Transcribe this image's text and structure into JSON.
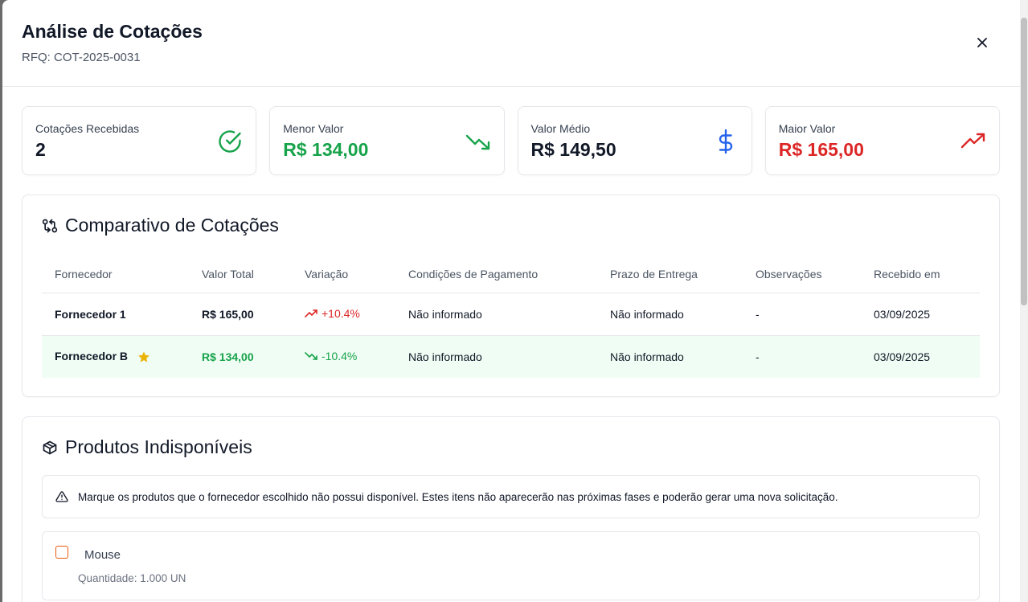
{
  "header": {
    "title": "Análise de Cotações",
    "subtitle": "RFQ: COT-2025-0031",
    "close_icon": "close-icon"
  },
  "stats": [
    {
      "label": "Cotações Recebidas",
      "value": "2",
      "icon": "check-circle-icon",
      "color": "#16a34a",
      "value_color": "#111827"
    },
    {
      "label": "Menor Valor",
      "value": "R$ 134,00",
      "icon": "trending-down-icon",
      "color": "#16a34a",
      "value_color": "#16a34a"
    },
    {
      "label": "Valor Médio",
      "value": "R$ 149,50",
      "icon": "dollar-icon",
      "color": "#2563eb",
      "value_color": "#111827"
    },
    {
      "label": "Maior Valor",
      "value": "R$ 165,00",
      "icon": "trending-up-icon",
      "color": "#dc2626",
      "value_color": "#dc2626"
    }
  ],
  "comparison": {
    "title": "Comparativo de Cotações",
    "icon": "git-compare-icon",
    "columns": [
      "Fornecedor",
      "Valor Total",
      "Variação",
      "Condições de Pagamento",
      "Prazo de Entrega",
      "Observações",
      "Recebido em"
    ],
    "rows": [
      {
        "supplier": "Fornecedor 1",
        "total": "R$ 165,00",
        "variation": "+10.4%",
        "trend": "up",
        "payment": "Não informado",
        "delivery": "Não informado",
        "notes": "-",
        "received": "03/09/2025",
        "best": false
      },
      {
        "supplier": "Fornecedor B",
        "total": "R$ 134,00",
        "variation": "-10.4%",
        "trend": "down",
        "payment": "Não informado",
        "delivery": "Não informado",
        "notes": "-",
        "received": "03/09/2025",
        "best": true
      }
    ]
  },
  "unavailable": {
    "title": "Produtos Indisponíveis",
    "icon": "package-icon",
    "alert_text": "Marque os produtos que o fornecedor escolhido não possui disponível. Estes itens não aparecerão nas próximas fases e poderão gerar uma nova solicitação.",
    "products": [
      {
        "name": "Mouse",
        "quantity": "Quantidade: 1.000 UN",
        "checked": false
      }
    ]
  },
  "colors": {
    "green": "#16a34a",
    "red": "#dc2626",
    "blue": "#2563eb",
    "best_row_bg": "#f0fdf4",
    "star": "#eab308",
    "checkbox_border": "#ea580c"
  }
}
